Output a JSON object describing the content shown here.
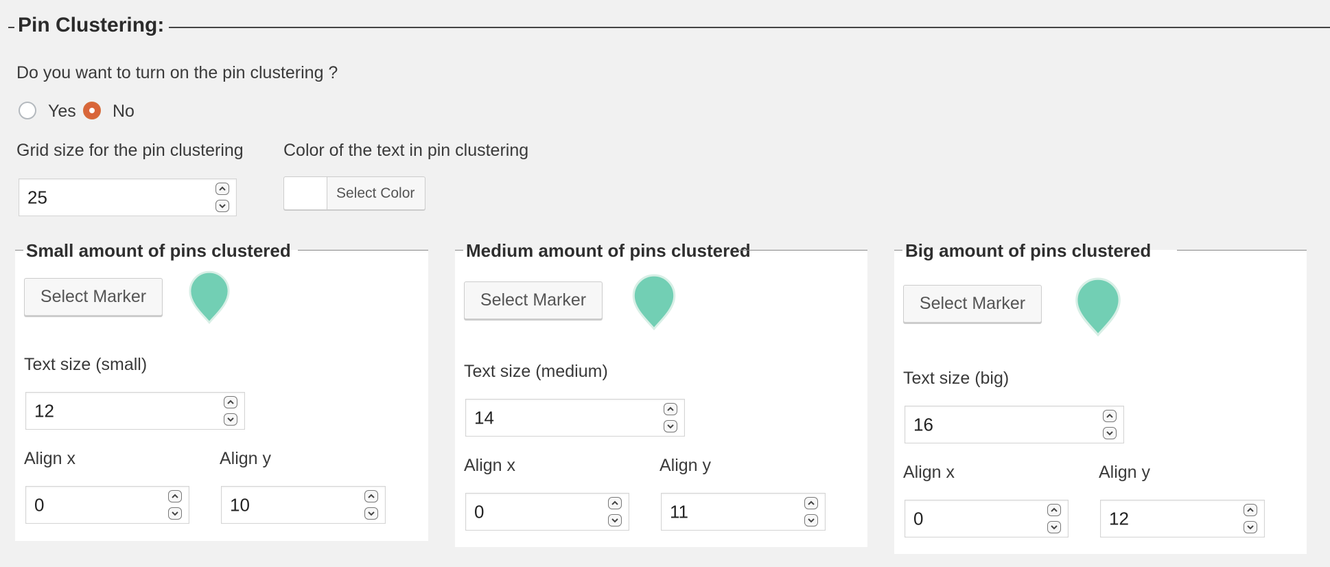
{
  "section": {
    "title": "Pin Clustering:"
  },
  "question": "Do you want to turn on the pin clustering ?",
  "radios": [
    {
      "label": "Yes",
      "checked": false
    },
    {
      "label": "No",
      "checked": true
    }
  ],
  "grid": {
    "label": "Grid size for the pin clustering",
    "value": "25"
  },
  "color": {
    "label": "Color of the text in pin clustering",
    "button_label": "Select Color"
  },
  "marker_color": "#72cfb4",
  "panels": [
    {
      "title": "Small amount of pins clustered",
      "button_label": "Select Marker",
      "text_size_label": "Text size (small)",
      "text_size": "12",
      "align_x_label": "Align x",
      "align_x": "0",
      "align_y_label": "Align y",
      "align_y": "10"
    },
    {
      "title": "Medium amount of pins clustered",
      "button_label": "Select Marker",
      "text_size_label": "Text size (medium)",
      "text_size": "14",
      "align_x_label": "Align x",
      "align_x": "0",
      "align_y_label": "Align y",
      "align_y": "11"
    },
    {
      "title": "Big amount of pins clustered",
      "button_label": "Select Marker",
      "text_size_label": "Text size (big)",
      "text_size": "16",
      "align_x_label": "Align x",
      "align_x": "0",
      "align_y_label": "Align y",
      "align_y": "12"
    }
  ]
}
